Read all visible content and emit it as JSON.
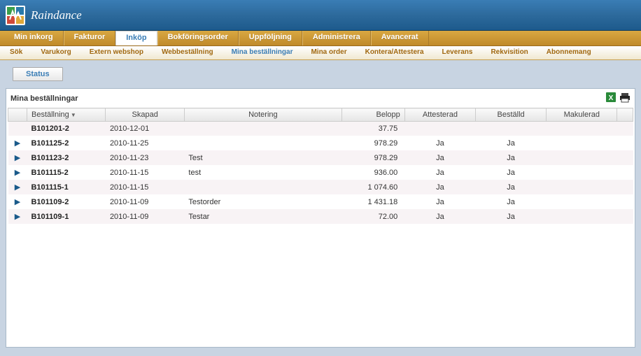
{
  "app": {
    "title": "Raindance"
  },
  "mainTabs": [
    {
      "label": "Min inkorg",
      "active": false
    },
    {
      "label": "Fakturor",
      "active": false
    },
    {
      "label": "Inköp",
      "active": true
    },
    {
      "label": "Bokföringsorder",
      "active": false
    },
    {
      "label": "Uppföljning",
      "active": false
    },
    {
      "label": "Administrera",
      "active": false
    },
    {
      "label": "Avancerat",
      "active": false
    }
  ],
  "subTabs": [
    {
      "label": "Sök",
      "active": false
    },
    {
      "label": "Varukorg",
      "active": false
    },
    {
      "label": "Extern webshop",
      "active": false
    },
    {
      "label": "Webbeställning",
      "active": false
    },
    {
      "label": "Mina beställningar",
      "active": true
    },
    {
      "label": "Mina order",
      "active": false
    },
    {
      "label": "Kontera/Attestera",
      "active": false
    },
    {
      "label": "Leverans",
      "active": false
    },
    {
      "label": "Rekvisition",
      "active": false
    },
    {
      "label": "Abonnemang",
      "active": false
    }
  ],
  "status": {
    "label": "Status"
  },
  "panel": {
    "title": "Mina beställningar",
    "columns": {
      "order": "Beställning",
      "created": "Skapad",
      "note": "Notering",
      "amount": "Belopp",
      "attested": "Attesterad",
      "ordered": "Beställd",
      "cancelled": "Makulerad"
    },
    "rows": [
      {
        "expandable": false,
        "order": "B101201-2",
        "created": "2010-12-01",
        "note": "",
        "amount": "37.75",
        "attested": "",
        "ordered": "",
        "cancelled": ""
      },
      {
        "expandable": true,
        "order": "B101125-2",
        "created": "2010-11-25",
        "note": "",
        "amount": "978.29",
        "attested": "Ja",
        "ordered": "Ja",
        "cancelled": ""
      },
      {
        "expandable": true,
        "order": "B101123-2",
        "created": "2010-11-23",
        "note": "Test",
        "amount": "978.29",
        "attested": "Ja",
        "ordered": "Ja",
        "cancelled": ""
      },
      {
        "expandable": true,
        "order": "B101115-2",
        "created": "2010-11-15",
        "note": "test",
        "amount": "936.00",
        "attested": "Ja",
        "ordered": "Ja",
        "cancelled": ""
      },
      {
        "expandable": true,
        "order": "B101115-1",
        "created": "2010-11-15",
        "note": "",
        "amount": "1 074.60",
        "attested": "Ja",
        "ordered": "Ja",
        "cancelled": ""
      },
      {
        "expandable": true,
        "order": "B101109-2",
        "created": "2010-11-09",
        "note": "Testorder",
        "amount": "1 431.18",
        "attested": "Ja",
        "ordered": "Ja",
        "cancelled": ""
      },
      {
        "expandable": true,
        "order": "B101109-1",
        "created": "2010-11-09",
        "note": "Testar",
        "amount": "72.00",
        "attested": "Ja",
        "ordered": "Ja",
        "cancelled": ""
      }
    ]
  }
}
